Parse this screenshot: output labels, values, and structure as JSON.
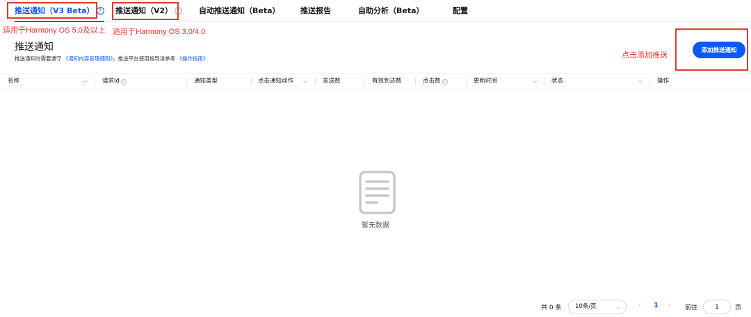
{
  "tabs": [
    {
      "label": "推送通知（V3 Beta）",
      "active": true
    },
    {
      "label": "推送通知（V2）",
      "active": false
    },
    {
      "label": "自动推送通知（Beta）",
      "active": false
    },
    {
      "label": "推送报告",
      "active": false
    },
    {
      "label": "自助分析（Beta）",
      "active": false
    },
    {
      "label": "配置",
      "active": false
    }
  ],
  "annotations": {
    "v3_note": "适用于Harmony OS 5.0及以上",
    "v2_note": "适用于Harmony OS 3.0/4.0",
    "add_note": "点击添加推送"
  },
  "header": {
    "title": "推送通知",
    "subtitle_prefix": "推送通知时需要遵守",
    "subtitle_link1": "《通知内容管理细则》",
    "subtitle_middle": "，推送平台使用指导请参考",
    "subtitle_link2": "《操作指南》",
    "add_button": "添加推送通知"
  },
  "table": {
    "columns": [
      "名称",
      "请求Id",
      "通知类型",
      "点击通知动作",
      "发送数",
      "有效到达数",
      "点击数",
      "更新时间",
      "状态",
      "操作"
    ]
  },
  "empty": {
    "text": "暂无数据",
    "icon": "document-icon"
  },
  "pagination": {
    "total": "共 0 条",
    "page_size": "10条/页",
    "current_page": "1",
    "goto_label": "前往",
    "goto_value": "1",
    "page_suffix": "页"
  },
  "colors": {
    "accent": "#0a59f7",
    "annotation": "#e5372e"
  }
}
